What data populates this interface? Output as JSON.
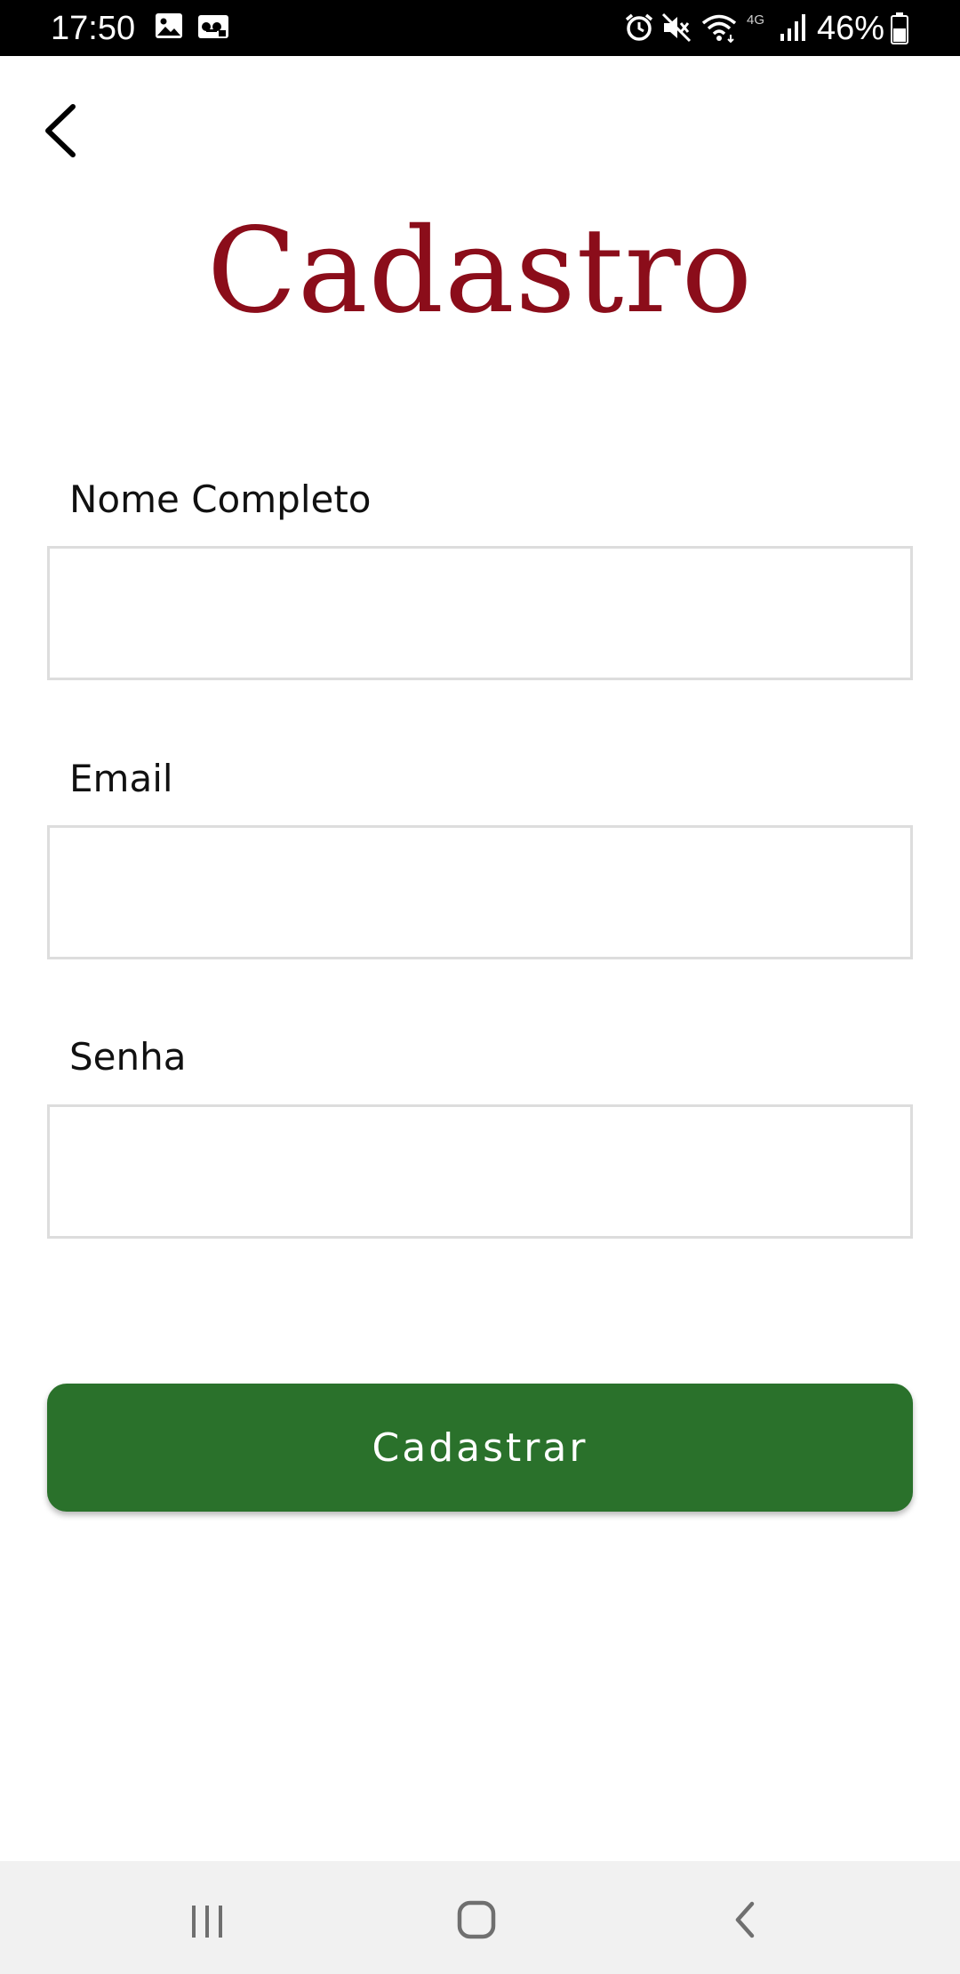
{
  "status_bar": {
    "time": "17:50",
    "network": "4G",
    "battery": "46%",
    "icons": [
      "gallery-icon",
      "voicemail-icon",
      "alarm-icon",
      "mute-icon",
      "wifi-icon",
      "signal-icon",
      "battery-icon"
    ]
  },
  "header": {
    "back_icon": "chevron-left-icon",
    "title": "Cadastro"
  },
  "form": {
    "fields": [
      {
        "label": "Nome Completo",
        "value": "",
        "placeholder": ""
      },
      {
        "label": "Email",
        "value": "",
        "placeholder": ""
      },
      {
        "label": "Senha",
        "value": "",
        "placeholder": ""
      }
    ],
    "submit_label": "Cadastrar"
  },
  "navigation_bar": {
    "buttons": [
      "recent-apps-icon",
      "home-icon",
      "back-icon"
    ]
  },
  "colors": {
    "title": "#8b0d1a",
    "button": "#2a712b",
    "status_bar": "#000000",
    "nav_bar": "#f1f1f1",
    "input_border": "#dddddd"
  }
}
